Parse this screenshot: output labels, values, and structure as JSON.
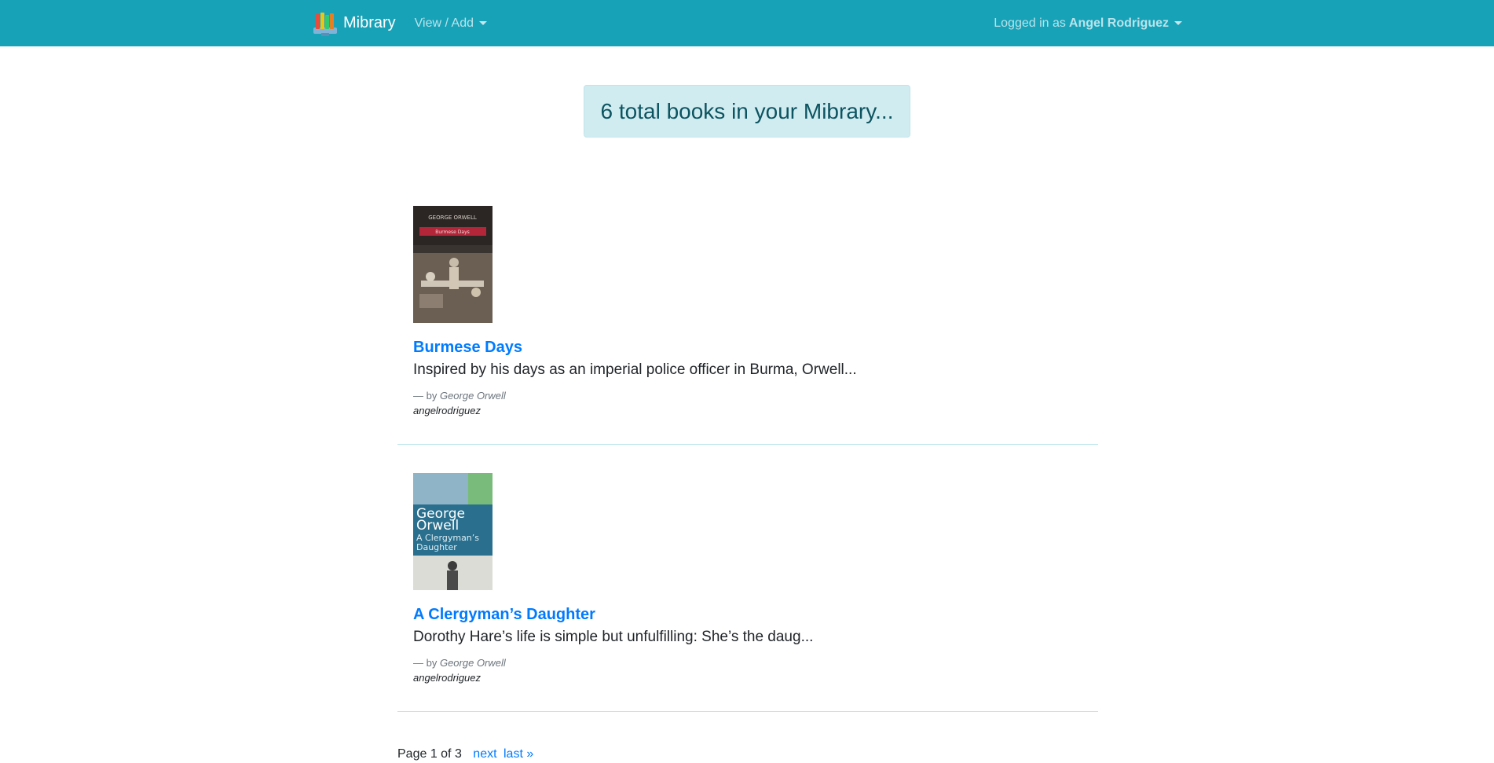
{
  "navbar": {
    "brand": "Mibrary",
    "menu_label": "View / Add",
    "user_prefix": "Logged in as",
    "user_name": "Angel Rodriguez"
  },
  "banner": {
    "text": "6 total books in your Mibrary..."
  },
  "books": [
    {
      "title": "Burmese Days",
      "description": "Inspired by his days as an imperial police officer in Burma, Orwell...",
      "by_prefix": "— by",
      "author": "George Orwell",
      "owner": "angelrodriguez",
      "cover_text": [
        "GEORGE ORWELL",
        "Burmese Days"
      ]
    },
    {
      "title": "A Clergyman’s Daughter",
      "description": "Dorothy Hare’s life is simple but unfulfilling: She’s the daug...",
      "by_prefix": "— by",
      "author": "George Orwell",
      "owner": "angelrodriguez",
      "cover_text": [
        "George",
        "Orwell",
        "A Clergyman’s",
        "Daughter"
      ]
    }
  ],
  "pagination": {
    "status": "Page 1 of 3",
    "next_label": "next",
    "last_label": "last »"
  },
  "colors": {
    "navbar": "#17a2b8",
    "link": "#007bff",
    "banner_bg": "#d1ecf1",
    "banner_text": "#0c5460"
  }
}
